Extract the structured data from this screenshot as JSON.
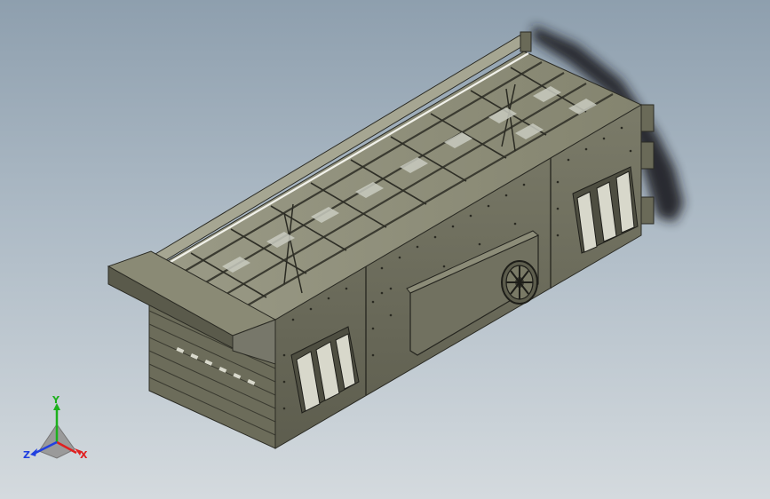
{
  "scene": {
    "model": "vibrating-screen-assembly",
    "background_top": "#8e9fae",
    "background_bottom": "#d4dade",
    "body_color": "#6e6e5c",
    "shadow_color": "#1c1f24"
  },
  "triad": {
    "x_label": "X",
    "y_label": "Y",
    "z_label": "Z",
    "x_color": "#e02020",
    "y_color": "#1db01d",
    "z_color": "#2040e0"
  }
}
